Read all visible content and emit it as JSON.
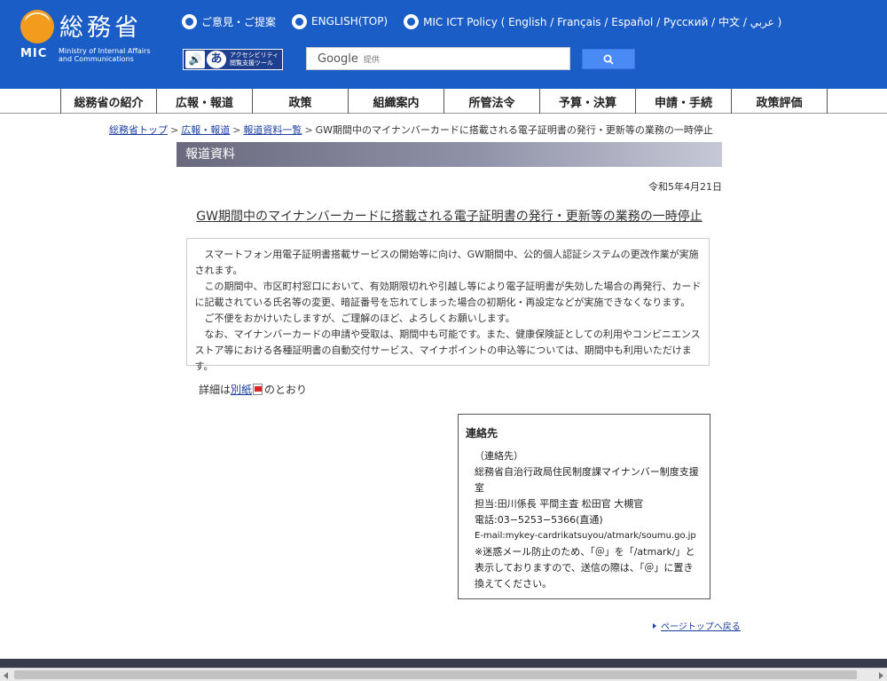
{
  "header": {
    "logo_kanji": "総務省",
    "logo_mic": "MIC",
    "logo_english_line1": "Ministry of Internal Affairs",
    "logo_english_line2": "and Communications",
    "toplinks": [
      {
        "label": "ご意見・ご提案"
      },
      {
        "label": "ENGLISH(TOP)"
      },
      {
        "label": "MIC ICT Policy ( English / Français / Español / Pусский / 中文 / عربي )"
      }
    ],
    "accessibility_line1": "アクセシビリティ",
    "accessibility_line2": "閲覧支援ツール",
    "accessibility_icon2": "あ",
    "search_brand": "Google",
    "search_suffix": "提供",
    "brand_color": "#1a5dc6"
  },
  "nav": {
    "items": [
      "総務省の紹介",
      "広報・報道",
      "政策",
      "組織案内",
      "所管法令",
      "予算・決算",
      "申請・手続",
      "政策評価"
    ]
  },
  "breadcrumb": {
    "items": [
      "総務省トップ",
      "広報・報道",
      "報道資料一覧"
    ],
    "separator": ">",
    "current": "GW期間中のマイナンバーカードに搭載される電子証明書の発行・更新等の業務の一時停止"
  },
  "section": {
    "title": "報道資料"
  },
  "article": {
    "date": "令和5年4月21日",
    "title": "GW期間中のマイナンバーカードに搭載される電子証明書の発行・更新等の業務の一時停止",
    "paragraphs": [
      "スマートフォン用電子証明書搭載サービスの開始等に向け、GW期間中、公的個人認証システムの更改作業が実施されます。",
      "この期間中、市区町村窓口において、有効期限切れや引越し等により電子証明書が失効した場合の再発行、カードに記載されている氏名等の変更、暗証番号を忘れてしまった場合の初期化・再設定などが実施できなくなります。",
      "ご不便をおかけいたしますが、ご理解のほど、よろしくお願いします。",
      "なお、マイナンバーカードの申請や受取は、期間中も可能です。また、健康保険証としての利用やコンビニエンスストア等における各種証明書の自動交付サービス、マイナポイントの申込等については、期間中も利用いただけます。"
    ],
    "detail_prefix": "詳細は",
    "detail_link": "別紙",
    "detail_suffix": "のとおり"
  },
  "contact": {
    "title": "連絡先",
    "lines": [
      "（連絡先）",
      "総務省自治行政局住民制度課マイナンバー制度支援室",
      "担当:田川係長 平間主査 松田官 大槻官",
      "電話:03−5253−5366(直通)"
    ],
    "email": "E-mail:mykey-cardrikatsuyou/atmark/soumu.go.jp",
    "note": "※迷惑メール防止のため、「＠」を「/atmark/」と表示しておりますので、送信の際は、「＠」に置き換えてください。"
  },
  "footer": {
    "pagetop": "ページトップへ戻る"
  }
}
